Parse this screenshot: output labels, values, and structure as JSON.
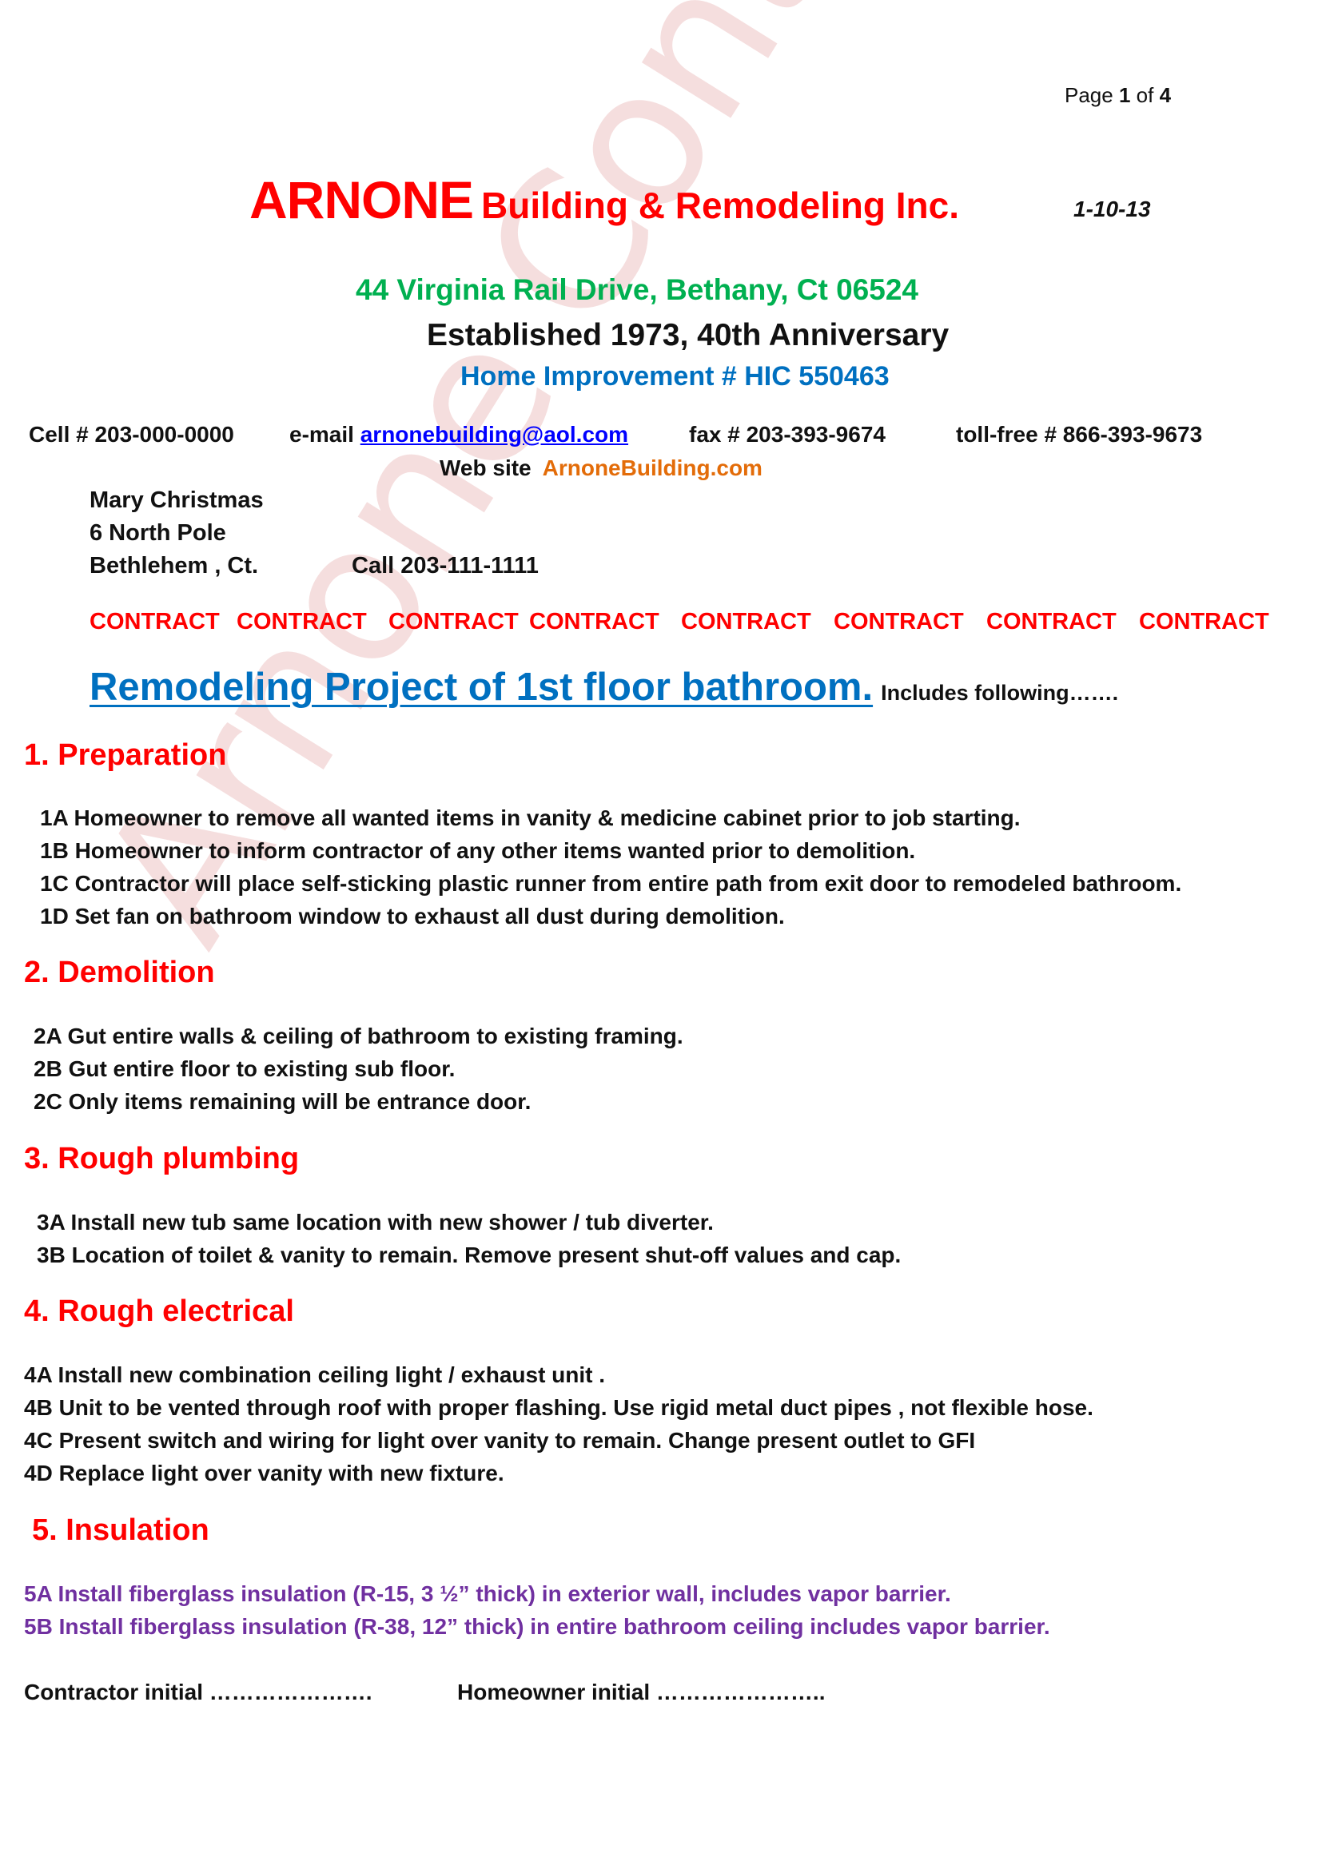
{
  "page": {
    "prefix": "Page",
    "current": "1",
    "of": "of",
    "total": "4"
  },
  "header": {
    "company_main": "ARNONE",
    "company_rest": "Building & Remodeling Inc.",
    "date": "1-10-13",
    "address": "44 Virginia Rail Drive, Bethany, Ct   06524",
    "established": "Established 1973, 40th Anniversary",
    "license": "Home Improvement #   HIC 550463"
  },
  "contact": {
    "cell": "Cell # 203-000-0000",
    "email_label": "e-mail",
    "email": "arnonebuilding@aol.com",
    "fax": "fax # 203-393-9674",
    "tollfree": "toll-free # 866-393-9673",
    "website_label": "Web site",
    "website": "ArnoneBuilding.com"
  },
  "customer": {
    "name": "Mary Christmas",
    "street": "6 North Pole",
    "city": "Bethlehem , Ct.",
    "phone": "Call 203-111-1111"
  },
  "contract_banner": [
    "CONTRACT",
    "CONTRACT",
    "CONTRACT",
    "CONTRACT",
    "CONTRACT",
    "CONTRACT",
    "CONTRACT",
    "CONTRACT"
  ],
  "project": {
    "title": "Remodeling Project of 1st floor bathroom.",
    "subtitle": "Includes following……."
  },
  "sections": [
    {
      "heading": "1.  Preparation",
      "items": [
        "1A   Homeowner to remove all wanted items in vanity & medicine cabinet prior to job starting.",
        "1B   Homeowner to inform contractor of any other items wanted prior to demolition.",
        "1C Contractor will place self-sticking plastic runner from entire path from exit door to remodeled bathroom.",
        "1D  Set fan on bathroom window to exhaust all dust during demolition."
      ]
    },
    {
      "heading": "2.  Demolition",
      "items": [
        "2A   Gut entire walls & ceiling of bathroom to existing framing.",
        "2B   Gut entire floor to existing sub floor.",
        "2C   Only items remaining will be entrance door."
      ]
    },
    {
      "heading": "3.  Rough plumbing",
      "items": [
        "3A  Install new tub same location with new shower / tub diverter.",
        "3B   Location of toilet & vanity to remain. Remove present shut-off values and cap."
      ]
    },
    {
      "heading": "4.  Rough electrical",
      "items": [
        "4A   Install new combination ceiling light / exhaust unit .",
        "4B   Unit to be vented through roof with proper flashing. Use rigid metal duct pipes , not flexible hose.",
        "4C   Present switch and wiring for light over vanity to remain. Change present outlet to GFI",
        "4D   Replace light over vanity with new fixture."
      ]
    },
    {
      "heading": "5.  Insulation",
      "items": [
        "5A   Install fiberglass insulation (R-15, 3 ½” thick) in exterior wall, includes vapor barrier.",
        "5B   Install fiberglass insulation (R-38, 12” thick) in entire bathroom ceiling includes vapor barrier."
      ]
    }
  ],
  "signatures": {
    "contractor": "Contractor initial   ………………….",
    "homeowner": "Homeowner initial   ………………….."
  },
  "watermark": "Arnone Contract",
  "colors": {
    "red": "#ff0000",
    "green": "#00b050",
    "blue": "#0070c0",
    "link": "#0000ff",
    "orange": "#e36c09",
    "purple": "#7030a0"
  }
}
